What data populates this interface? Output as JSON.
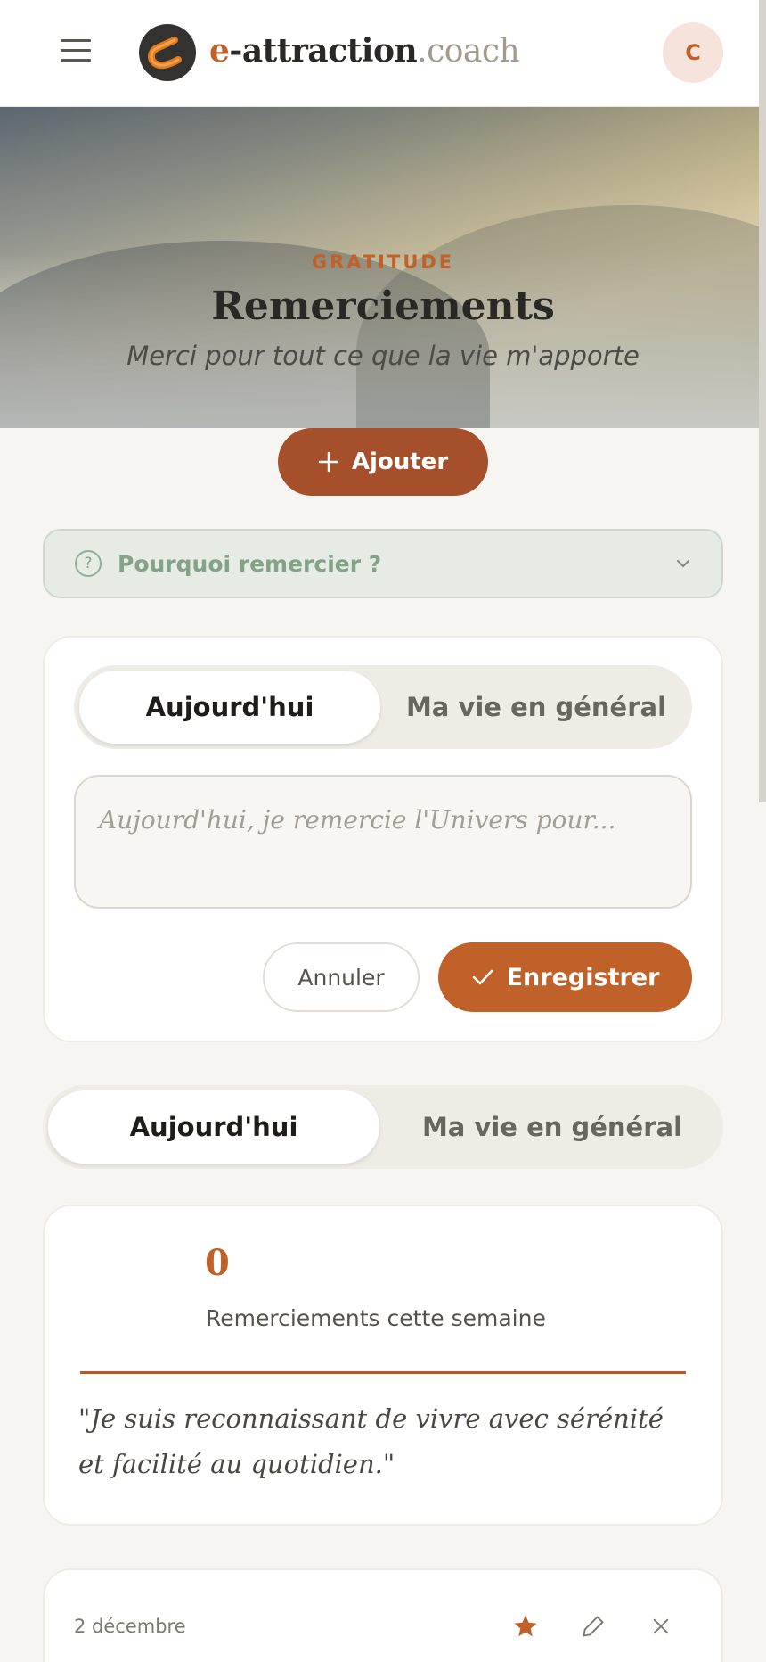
{
  "header": {
    "logo_prefix": "e",
    "logo_main": "-attraction",
    "logo_suffix": ".coach",
    "avatar_initial": "C"
  },
  "hero": {
    "eyebrow": "GRATITUDE",
    "title": "Remerciements",
    "subtitle": "Merci pour tout ce que la vie m'apporte"
  },
  "add_button": {
    "label": "Ajouter"
  },
  "why_panel": {
    "label": "Pourquoi remercier ?"
  },
  "form": {
    "tabs": [
      {
        "label": "Aujourd'hui",
        "active": true
      },
      {
        "label": "Ma vie en général",
        "active": false
      }
    ],
    "placeholder": "Aujourd'hui, je remercie l'Univers pour...",
    "cancel_label": "Annuler",
    "save_label": "Enregistrer"
  },
  "filter": {
    "tabs": [
      {
        "label": "Aujourd'hui",
        "active": true
      },
      {
        "label": "Ma vie en général",
        "active": false
      }
    ]
  },
  "stats": {
    "count": "0",
    "count_label": "Remerciements cette semaine",
    "quote": "\"Je suis reconnaissant de vivre avec sérénité et facilité au quotidien.\""
  },
  "entry": {
    "date": "2 décembre",
    "starred": true
  },
  "colors": {
    "accent": "#c0612a",
    "accent_dark": "#a5502a",
    "sage": "#82a388",
    "background": "#f6f5f1"
  },
  "icons": [
    "menu-icon",
    "logo-magnet-icon",
    "plus-icon",
    "help-circle-icon",
    "chevron-down-icon",
    "check-icon",
    "star-icon",
    "pencil-icon",
    "close-icon"
  ]
}
